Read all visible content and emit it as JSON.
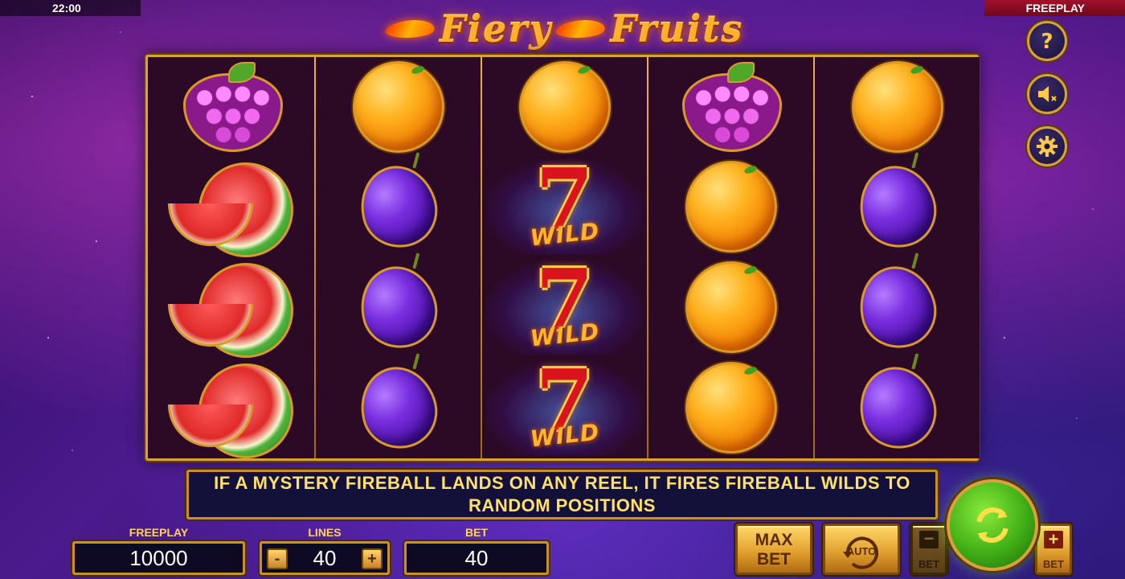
{
  "status": {
    "clock": "22:00",
    "mode": "FREEPLAY"
  },
  "title": {
    "word1": "Fiery",
    "word2": "Fruits"
  },
  "reels": [
    [
      "grapes",
      "watermelon",
      "watermelon",
      "watermelon"
    ],
    [
      "orange",
      "plum",
      "plum",
      "plum"
    ],
    [
      "orange",
      "wild",
      "wild",
      "wild"
    ],
    [
      "grapes",
      "orange",
      "orange",
      "orange"
    ],
    [
      "orange",
      "plum",
      "plum",
      "plum"
    ]
  ],
  "wild_label": "WILD",
  "side_buttons": [
    {
      "name": "help",
      "icon": "question-icon"
    },
    {
      "name": "sound",
      "icon": "speaker-muted-icon"
    },
    {
      "name": "settings",
      "icon": "gear-icon"
    }
  ],
  "message": "IF A MYSTERY FIREBALL LANDS ON ANY REEL, IT FIRES FIREBALL WILDS TO RANDOM POSITIONS",
  "panel": {
    "balance_label": "FREEPLAY",
    "balance_value": "10000",
    "lines_label": "LINES",
    "lines_value": "40",
    "lines_minus": "-",
    "lines_plus": "+",
    "bet_label": "BET",
    "bet_value": "40"
  },
  "buttons": {
    "max_bet_line1": "MAX",
    "max_bet_line2": "BET",
    "auto": "AUTO",
    "bet_minus_symbol": "−",
    "bet_minus_label": "BET",
    "bet_plus_symbol": "+",
    "bet_plus_label": "BET",
    "spin_icon": "refresh-icon"
  },
  "colors": {
    "accent_gold": "#d9a13a",
    "message_text": "#ffe16a",
    "spin_green": "#3fae16"
  }
}
